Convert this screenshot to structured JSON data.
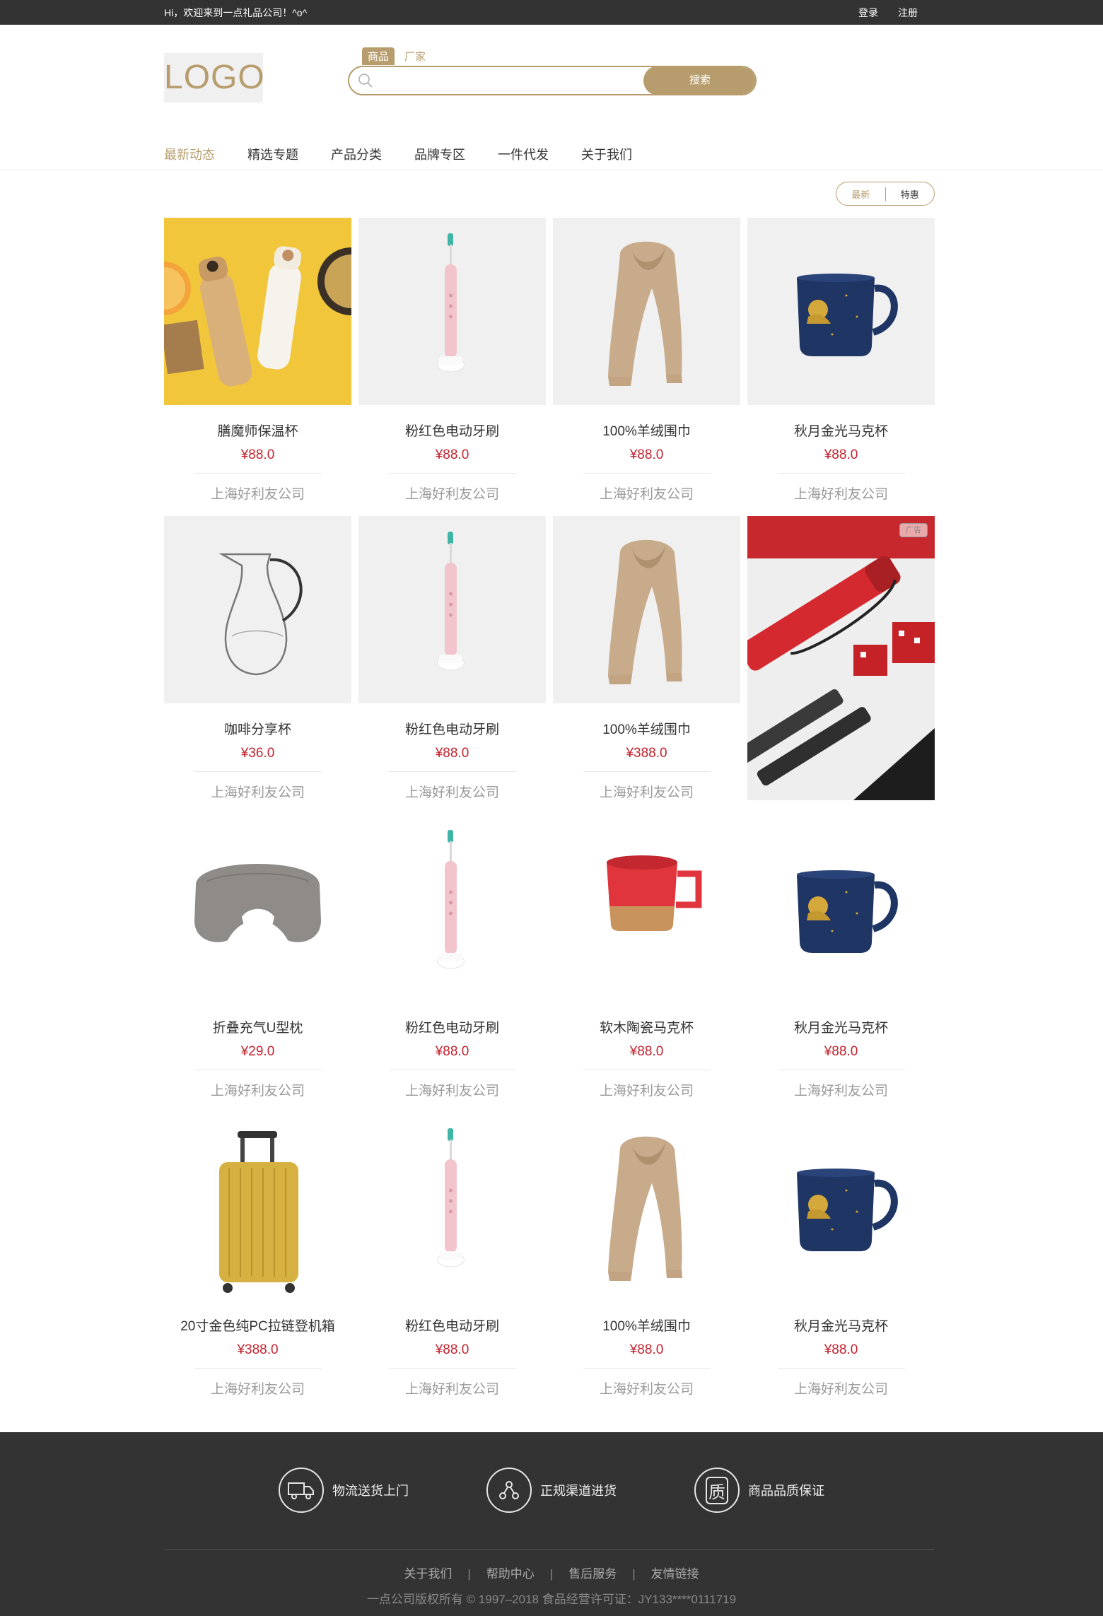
{
  "topbar": {
    "welcome": "Hi，欢迎来到一点礼品公司！^o^",
    "login": "登录",
    "register": "注册"
  },
  "header": {
    "logo": "LOGO"
  },
  "search": {
    "tab_goods": "商品",
    "tab_factory": "厂家",
    "placeholder": "",
    "button": "搜索"
  },
  "nav": {
    "items": [
      "最新动态",
      "精选专题",
      "产品分类",
      "品牌专区",
      "一件代发",
      "关于我们"
    ]
  },
  "sort_toggle": {
    "latest": "最新",
    "special": "特惠"
  },
  "ad": {
    "badge": "广告"
  },
  "products": [
    {
      "name": "膳魔师保温杯",
      "price": "¥88.0",
      "company": "上海好利友公司",
      "image": "thermos-bottles"
    },
    {
      "name": "粉红色电动牙刷",
      "price": "¥88.0",
      "company": "上海好利友公司",
      "image": "pink-toothbrush"
    },
    {
      "name": "100%羊绒围巾",
      "price": "¥88.0",
      "company": "上海好利友公司",
      "image": "cashmere-scarf"
    },
    {
      "name": "秋月金光马克杯",
      "price": "¥88.0",
      "company": "上海好利友公司",
      "image": "blue-mug"
    },
    {
      "name": "咖啡分享杯",
      "price": "¥36.0",
      "company": "上海好利友公司",
      "image": "glass-carafe"
    },
    {
      "name": "粉红色电动牙刷",
      "price": "¥88.0",
      "company": "上海好利友公司",
      "image": "pink-toothbrush"
    },
    {
      "name": "100%羊绒围巾",
      "price": "¥388.0",
      "company": "上海好利友公司",
      "image": "cashmere-scarf"
    },
    {
      "name": "折叠充气U型枕",
      "price": "¥29.0",
      "company": "上海好利友公司",
      "image": "neck-pillow"
    },
    {
      "name": "粉红色电动牙刷",
      "price": "¥88.0",
      "company": "上海好利友公司",
      "image": "pink-toothbrush"
    },
    {
      "name": "软木陶瓷马克杯",
      "price": "¥88.0",
      "company": "上海好利友公司",
      "image": "red-mug"
    },
    {
      "name": "秋月金光马克杯",
      "price": "¥88.0",
      "company": "上海好利友公司",
      "image": "blue-mug"
    },
    {
      "name": "20寸金色纯PC拉链登机箱",
      "price": "¥388.0",
      "company": "上海好利友公司",
      "image": "gold-suitcase"
    },
    {
      "name": "粉红色电动牙刷",
      "price": "¥88.0",
      "company": "上海好利友公司",
      "image": "pink-toothbrush"
    },
    {
      "name": "100%羊绒围巾",
      "price": "¥88.0",
      "company": "上海好利友公司",
      "image": "cashmere-scarf"
    },
    {
      "name": "秋月金光马克杯",
      "price": "¥88.0",
      "company": "上海好利友公司",
      "image": "blue-mug"
    }
  ],
  "footer": {
    "features": [
      {
        "label": "物流送货上门",
        "icon": "truck-icon"
      },
      {
        "label": "正规渠道进货",
        "icon": "network-icon"
      },
      {
        "label": "商品品质保证",
        "icon": "quality-icon",
        "glyph": "质"
      }
    ],
    "links": [
      "关于我们",
      "帮助中心",
      "售后服务",
      "友情链接"
    ],
    "copyright": "一点公司版权所有 © 1997–2018    食品经营许可证：JY133****0111719"
  },
  "colors": {
    "accent": "#b79d6d",
    "price": "#c4232f",
    "dark": "#333333"
  }
}
